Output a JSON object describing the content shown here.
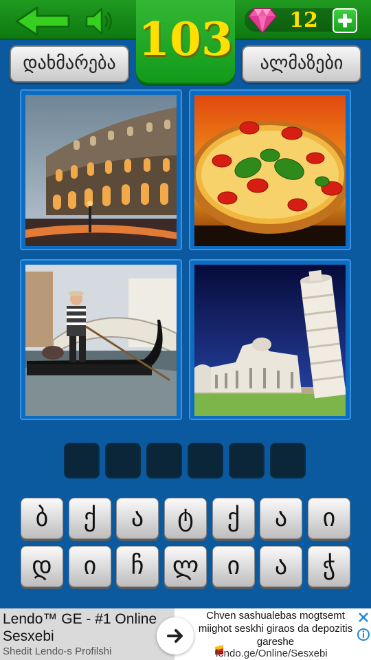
{
  "header": {
    "level": "103",
    "gem_count": "12",
    "back_icon": "arrow-left-icon",
    "sound_icon": "speaker-icon",
    "gem_icon": "diamond-icon",
    "add_icon": "plus-icon"
  },
  "buttons": {
    "hint_label": "დახმარება",
    "gems_label": "ალმაზები"
  },
  "puzzle": {
    "images": [
      "colosseum",
      "pizza",
      "gondola",
      "leaning-tower"
    ],
    "answer_slots": [
      "",
      "",
      "",
      "",
      "",
      ""
    ]
  },
  "keyboard": {
    "row1": [
      "ბ",
      "ქ",
      "ა",
      "ტ",
      "ქ",
      "ა",
      "ი"
    ],
    "row2": [
      "დ",
      "ი",
      "ჩ",
      "ლ",
      "ი",
      "ა",
      "ჭ"
    ]
  },
  "ad": {
    "title": "Lendo™ GE - #1 Online Sesxebi",
    "subtitle": "Shedit Lendo-s Profilshi",
    "body": "Chven sashualebas mogtsemt miighot seskhi giraos da depozitis gareshe",
    "url": "lendo.ge/Online/Sesxebi"
  },
  "colors": {
    "background": "#0b5aa0",
    "top_bar": "#129214",
    "level_text": "#ffe000",
    "slot": "#0b2638"
  }
}
